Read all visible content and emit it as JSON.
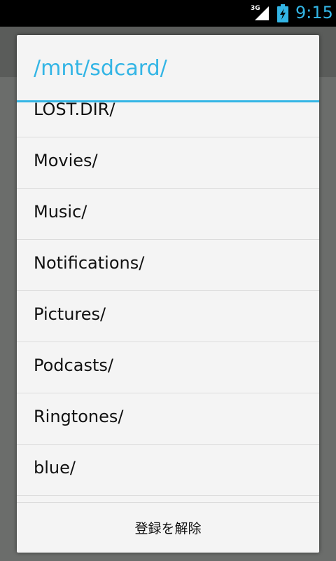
{
  "status_bar": {
    "network_label": "3G",
    "time": "9:15",
    "clock_color": "#33b5e5"
  },
  "dialog": {
    "title": "/mnt/sdcard/",
    "accent_color": "#33b5e5",
    "items": [
      {
        "label": "LOST.DIR/"
      },
      {
        "label": "Movies/"
      },
      {
        "label": "Music/"
      },
      {
        "label": "Notifications/"
      },
      {
        "label": "Pictures/"
      },
      {
        "label": "Podcasts/"
      },
      {
        "label": "Ringtones/"
      },
      {
        "label": "blue/"
      }
    ],
    "footer_button": "登録を解除"
  }
}
